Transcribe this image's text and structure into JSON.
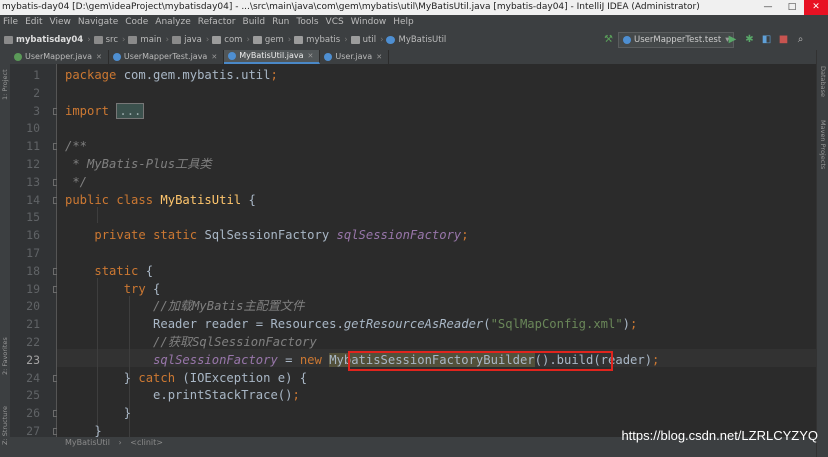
{
  "window": {
    "title": "mybatis-day04 [D:\\gem\\ideaProject\\mybatisday04] - ...\\src\\main\\java\\com\\gem\\mybatis\\util\\MyBatisUtil.java [mybatis-day04] - IntelliJ IDEA (Administrator)",
    "minimize": "—",
    "maximize": "□",
    "close": "✕"
  },
  "menu": [
    "File",
    "Edit",
    "View",
    "Navigate",
    "Code",
    "Analyze",
    "Refactor",
    "Build",
    "Run",
    "Tools",
    "VCS",
    "Window",
    "Help"
  ],
  "breadcrumbs": [
    "mybatisday04",
    "src",
    "main",
    "java",
    "com",
    "gem",
    "mybatis",
    "util",
    "MyBatisUtil"
  ],
  "run_config": {
    "label": "UserMapperTest.test"
  },
  "toolbar_icons": [
    "run-icon",
    "debug-icon",
    "coverage-icon",
    "stop-icon",
    "search-icon"
  ],
  "tabs": [
    {
      "label": "UserMapper.java",
      "active": false
    },
    {
      "label": "UserMapperTest.java",
      "active": false
    },
    {
      "label": "MyBatisUtil.java",
      "active": true
    },
    {
      "label": "User.java",
      "active": false
    }
  ],
  "left_tool_windows": {
    "project": "1: Project",
    "favorites": "2: Favorites",
    "structure": "Z: Structure"
  },
  "right_tool_windows": {
    "database": "Database",
    "maven": "Maven Projects"
  },
  "editor": {
    "current_line": 23,
    "lines": [
      {
        "n": 1,
        "code": "package com.gem.mybatis.util;"
      },
      {
        "n": 2,
        "code": ""
      },
      {
        "n": 3,
        "code": "import ..."
      },
      {
        "n": 10,
        "code": ""
      },
      {
        "n": 11,
        "code": "/**"
      },
      {
        "n": 12,
        "code": " * MyBatis-Plus工具类"
      },
      {
        "n": 13,
        "code": " */"
      },
      {
        "n": 14,
        "code": "public class MyBatisUtil {"
      },
      {
        "n": 15,
        "code": ""
      },
      {
        "n": 16,
        "code": "    private static SqlSessionFactory sqlSessionFactory;"
      },
      {
        "n": 17,
        "code": ""
      },
      {
        "n": 18,
        "code": "    static {"
      },
      {
        "n": 19,
        "code": "        try {"
      },
      {
        "n": 20,
        "code": "            //加载MyBatis主配置文件"
      },
      {
        "n": 21,
        "code": "            Reader reader = Resources.getResourceAsReader(\"SqlMapConfig.xml\");"
      },
      {
        "n": 22,
        "code": "            //获取SqlSessionFactory"
      },
      {
        "n": 23,
        "code": "            sqlSessionFactory = new MybatisSessionFactoryBuilder().build(reader);"
      },
      {
        "n": 24,
        "code": "        } catch (IOException e) {"
      },
      {
        "n": 25,
        "code": "            e.printStackTrace();"
      },
      {
        "n": 26,
        "code": "        }"
      },
      {
        "n": 27,
        "code": "    }"
      }
    ]
  },
  "status": {
    "breadcrumb": [
      "MyBatisUtil",
      "<clinit>"
    ]
  },
  "watermark": "https://blog.csdn.net/LZRLCYZYQ",
  "colors": {
    "keyword": "#cc7832",
    "method_decl": "#ffc66d",
    "string": "#6a8759",
    "comment": "#808080",
    "field": "#9876aa",
    "highlight_box": "#e0241d"
  }
}
